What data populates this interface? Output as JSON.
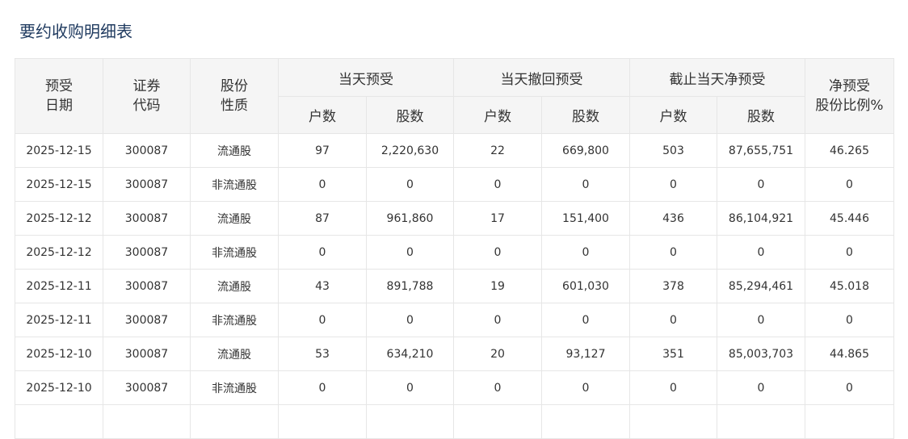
{
  "title": "要约收购明细表",
  "headers": {
    "date": [
      "预受",
      "日期"
    ],
    "code": [
      "证券",
      "代码"
    ],
    "nature": [
      "股份",
      "性质"
    ],
    "group_today": "当天预受",
    "group_withdraw": "当天撤回预受",
    "group_net": "截止当天净预受",
    "ratio": [
      "净预受",
      "股份比例%"
    ],
    "households": "户数",
    "shares": "股数"
  },
  "rows": [
    [
      "2025-12-15",
      "300087",
      "流通股",
      "97",
      "2,220,630",
      "22",
      "669,800",
      "503",
      "87,655,751",
      "46.265"
    ],
    [
      "2025-12-15",
      "300087",
      "非流通股",
      "0",
      "0",
      "0",
      "0",
      "0",
      "0",
      "0"
    ],
    [
      "2025-12-12",
      "300087",
      "流通股",
      "87",
      "961,860",
      "17",
      "151,400",
      "436",
      "86,104,921",
      "45.446"
    ],
    [
      "2025-12-12",
      "300087",
      "非流通股",
      "0",
      "0",
      "0",
      "0",
      "0",
      "0",
      "0"
    ],
    [
      "2025-12-11",
      "300087",
      "流通股",
      "43",
      "891,788",
      "19",
      "601,030",
      "378",
      "85,294,461",
      "45.018"
    ],
    [
      "2025-12-11",
      "300087",
      "非流通股",
      "0",
      "0",
      "0",
      "0",
      "0",
      "0",
      "0"
    ],
    [
      "2025-12-10",
      "300087",
      "流通股",
      "53",
      "634,210",
      "20",
      "93,127",
      "351",
      "85,003,703",
      "44.865"
    ],
    [
      "2025-12-10",
      "300087",
      "非流通股",
      "0",
      "0",
      "0",
      "0",
      "0",
      "0",
      "0"
    ],
    [
      "",
      "",
      "",
      "",
      "",
      "",
      "",
      "",
      "",
      ""
    ]
  ]
}
